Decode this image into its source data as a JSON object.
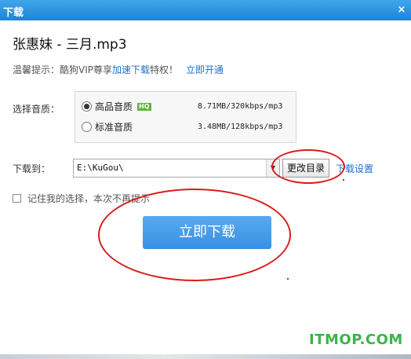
{
  "window": {
    "title": "下载",
    "close_glyph": "×"
  },
  "song": {
    "title": "张惠妹 - 三月.mp3"
  },
  "tip": {
    "prefix": "温馨提示：酷狗VIP尊享",
    "link_accel": "加速下载",
    "mid": "特权！",
    "link_open": "立即开通"
  },
  "quality": {
    "label": "选择音质：",
    "options": [
      {
        "label": "高品音质",
        "badge": "HQ",
        "size": "8.71MB/320kbps/mp3",
        "selected": true
      },
      {
        "label": "标准音质",
        "badge": "",
        "size": "3.48MB/128kbps/mp3",
        "selected": false
      }
    ]
  },
  "download": {
    "label": "下载到：",
    "path": "E:\\KuGou\\",
    "change_dir_label": "更改目录",
    "settings_label": "下载设置",
    "remember_label": "记住我的选择，本次不再提示",
    "remember_checked": false,
    "button_label": "立即下载"
  },
  "watermark": "ITMOP.COM",
  "colors": {
    "accent": "#3a8fe2",
    "link": "#1e6fcc",
    "annotation": "#d91d1d",
    "watermark": "#3cb34b"
  }
}
